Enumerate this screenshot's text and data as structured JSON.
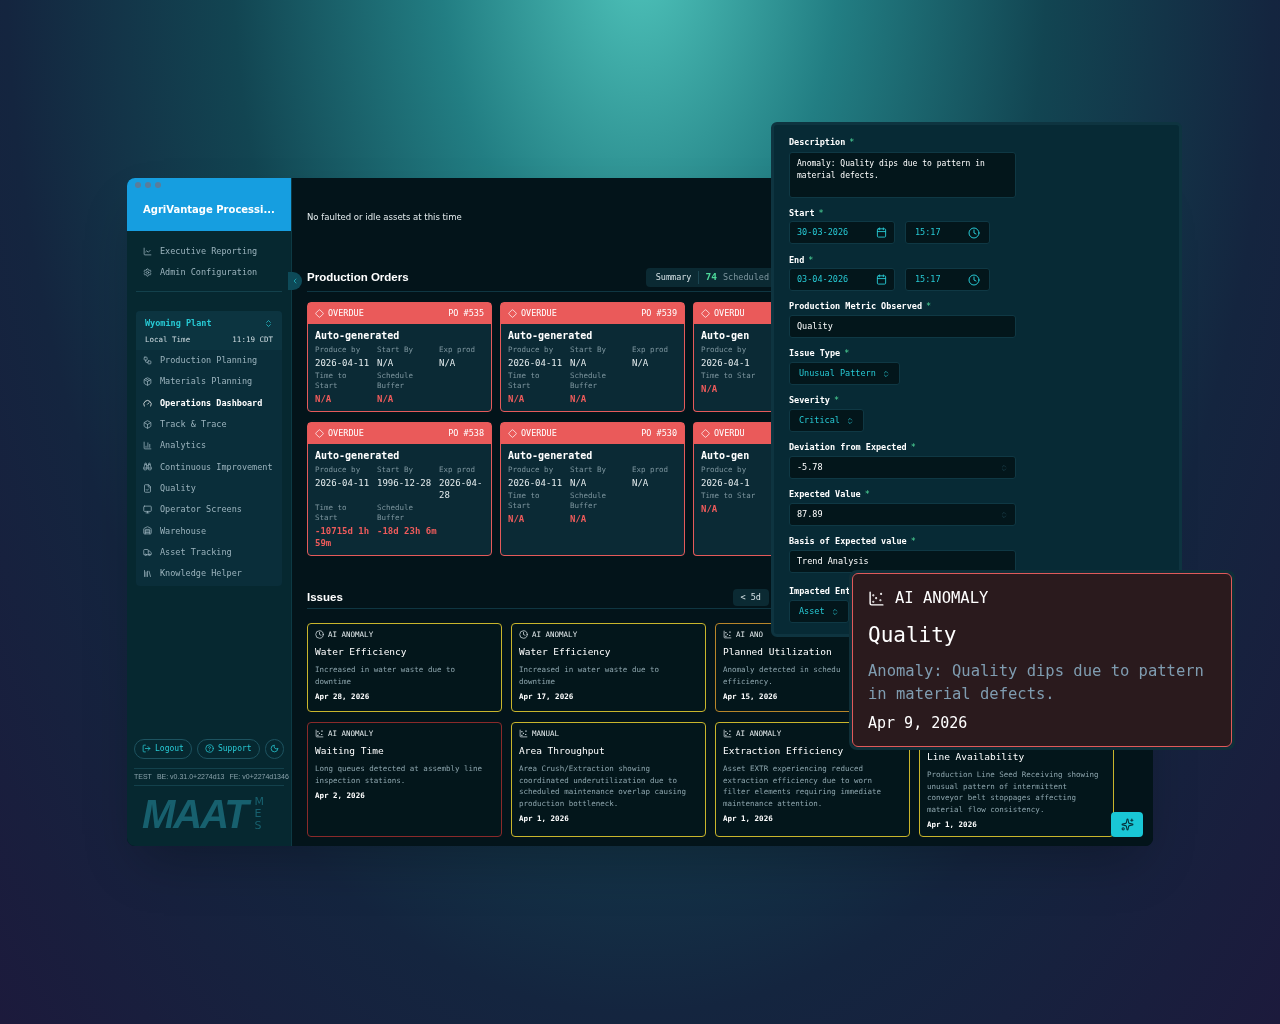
{
  "sidebar": {
    "org": "AgriVantage Processi...",
    "top_items": [
      {
        "label": "Executive Reporting"
      },
      {
        "label": "Admin Configuration"
      }
    ],
    "plant": {
      "name": "Wyoming Plant",
      "time_label": "Local Time",
      "time": "11:19 CDT"
    },
    "nav_items": [
      {
        "label": "Production Planning",
        "selected": false
      },
      {
        "label": "Materials Planning",
        "selected": false
      },
      {
        "label": "Operations Dashboard",
        "selected": true
      },
      {
        "label": "Track & Trace",
        "selected": false
      },
      {
        "label": "Analytics",
        "selected": false
      },
      {
        "label": "Continuous Improvement",
        "selected": false
      },
      {
        "label": "Quality",
        "selected": false
      },
      {
        "label": "Operator Screens",
        "selected": false
      },
      {
        "label": "Warehouse",
        "selected": false
      },
      {
        "label": "Asset Tracking",
        "selected": false
      },
      {
        "label": "Knowledge Helper",
        "selected": false
      }
    ],
    "buttons": [
      "Logout",
      "Support"
    ],
    "version": [
      "TEST",
      "BE: v0.31.0+2274d13",
      "FE: v0+2274d1346"
    ],
    "logo": "MAAT",
    "logo_sub": "MES"
  },
  "notice": "No faulted or idle assets at this time",
  "production_orders": {
    "title": "Production Orders",
    "summary": "Summary",
    "count": "74",
    "count_label": "Scheduled",
    "orders": [
      {
        "kind": "full",
        "status": "OVERDUE",
        "po": "PO #535",
        "title": "Auto-generated",
        "fields": [
          {
            "label": "Produce by",
            "value": "2026-04-11"
          },
          {
            "label": "Start By",
            "value": "N/A"
          },
          {
            "label": "Exp prod",
            "value": "N/A"
          },
          {
            "label": "Time to Start",
            "value": "N/A"
          },
          {
            "label": "Schedule Buffer",
            "value": "N/A"
          }
        ]
      },
      {
        "kind": "full",
        "status": "OVERDUE",
        "po": "PO #539",
        "title": "Auto-generated",
        "fields": [
          {
            "label": "Produce by",
            "value": "2026-04-11"
          },
          {
            "label": "Start By",
            "value": "N/A"
          },
          {
            "label": "Exp prod",
            "value": "N/A"
          },
          {
            "label": "Time to Start",
            "value": "N/A"
          },
          {
            "label": "Schedule Buffer",
            "value": "N/A"
          }
        ]
      },
      {
        "kind": "clipped",
        "status": "OVERDU",
        "title": "Auto-gen",
        "fields": [
          {
            "label": "Produce by",
            "value": "2026-04-1"
          },
          {
            "label": "Time to Star",
            "value": "N/A"
          }
        ]
      },
      {
        "kind": "full",
        "status": "OVERDUE",
        "po": "PO #538",
        "title": "Auto-generated",
        "fields": [
          {
            "label": "Produce by",
            "value": "2026-04-11"
          },
          {
            "label": "Start By",
            "value": "1996-12-28"
          },
          {
            "label": "Exp prod",
            "value": "2026-04-28"
          },
          {
            "label": "Time to Start",
            "value": "-10715d 1h 59m"
          },
          {
            "label": "Schedule Buffer",
            "value": "-18d 23h 6m"
          }
        ]
      },
      {
        "kind": "full",
        "status": "OVERDUE",
        "po": "PO #530",
        "title": "Auto-generated",
        "fields": [
          {
            "label": "Produce by",
            "value": "2026-04-11"
          },
          {
            "label": "Start By",
            "value": "N/A"
          },
          {
            "label": "Exp prod",
            "value": "N/A"
          },
          {
            "label": "Time to Start",
            "value": "N/A"
          },
          {
            "label": "Schedule Buffer",
            "value": "N/A"
          }
        ]
      },
      {
        "kind": "clipped",
        "status": "OVERDU",
        "title": "Auto-gen",
        "fields": [
          {
            "label": "Produce by",
            "value": "2026-04-1"
          },
          {
            "label": "Time to Star",
            "value": "N/A"
          }
        ]
      }
    ]
  },
  "issues": {
    "title": "Issues",
    "range": "< 5d",
    "cards": [
      {
        "kind": "full",
        "source": "AI ANOMALY",
        "title": "Water Efficiency",
        "description": "Increased in water waste due to downtime",
        "date": "Apr 28, 2026",
        "color": "#c9b52c"
      },
      {
        "kind": "full",
        "source": "AI ANOMALY",
        "title": "Water Efficiency",
        "description": "Increased in water waste due to downtime",
        "date": "Apr 17, 2026",
        "color": "#c9b52c"
      },
      {
        "kind": "clipped",
        "source": "AI ANO",
        "title": "Planned Utilization",
        "lines": [
          "Anomaly detected in schedu",
          "efficiency."
        ],
        "date": "Apr 15, 2026",
        "color": "#b8862a"
      },
      {
        "kind": "hidden"
      },
      {
        "kind": "full",
        "source": "AI ANOMALY",
        "title": "Waiting Time",
        "description": "Long queues detected at assembly line inspection stations.",
        "date": "Apr 2, 2026",
        "color": "#8a2a2a"
      },
      {
        "kind": "full",
        "source": "MANUAL",
        "title": "Area Throughput",
        "description": "Area Crush/Extraction showing coordinated underutilization due to scheduled maintenance overlap causing production bottleneck.",
        "date": "Apr 1, 2026",
        "color": "#c9b52c"
      },
      {
        "kind": "full",
        "source": "AI ANOMALY",
        "title": "Extraction Efficiency",
        "description": "Asset EXTR experiencing reduced extraction efficiency due to worn filter elements requiring immediate maintenance attention.",
        "date": "Apr 1, 2026",
        "color": "#c9b52c"
      },
      {
        "kind": "covered",
        "title": "Line Availability",
        "description": "Production Line Seed Receiving showing unusual pattern of intermittent conveyor belt stoppages affecting material flow consistency.",
        "date": "Apr 1, 2026",
        "color": "#c9b52c"
      }
    ]
  },
  "form": {
    "fields": [
      {
        "kind": "textarea",
        "label": "Description",
        "mark": "*",
        "value": "Anomaly: Quality dips due to pattern in material defects."
      },
      {
        "kind": "datetime",
        "label": "Start",
        "mark": "*",
        "date": "30-03-2026",
        "time": "15:17"
      },
      {
        "kind": "datetime",
        "label": "End",
        "mark": "*",
        "date": "03-04-2026",
        "time": "15:17"
      },
      {
        "kind": "text",
        "label": "Production Metric Observed",
        "mark": "*",
        "value": "Quality"
      },
      {
        "kind": "select",
        "label": "Issue Type",
        "mark": "*",
        "value": "Unusual Pattern"
      },
      {
        "kind": "select",
        "label": "Severity",
        "mark": "*",
        "value": "Critical"
      },
      {
        "kind": "number",
        "label": "Deviation from Expected",
        "mark": "*",
        "value": "-5.78"
      },
      {
        "kind": "number",
        "label": "Expected Value",
        "mark": "*",
        "value": "87.89"
      },
      {
        "kind": "text",
        "label": "Basis of Expected value",
        "mark": "*",
        "value": "Trend Analysis"
      },
      {
        "kind": "select",
        "label": "Impacted Ent",
        "value": "Asset"
      }
    ]
  },
  "popup": {
    "source": "AI ANOMALY",
    "title": "Quality",
    "description": "Anomaly: Quality dips due to pattern in material defects.",
    "date": "Apr 9, 2026"
  }
}
